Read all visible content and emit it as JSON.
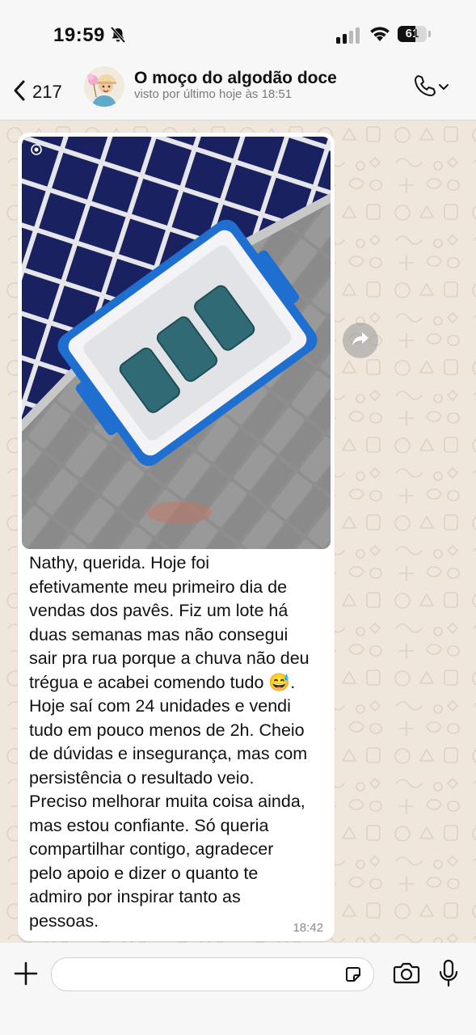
{
  "status_bar": {
    "time": "19:59",
    "battery": "61",
    "icons": [
      "bell-slash-icon",
      "signal-icon",
      "wifi-icon",
      "battery-icon"
    ]
  },
  "header": {
    "back_count": "217",
    "contact_name": "O moço do algodão doce",
    "last_seen": "visto por último hoje às 18:51",
    "icons": [
      "chevron-left-icon",
      "phone-icon",
      "chevron-down-icon"
    ]
  },
  "message": {
    "text": "Nathy, querida. Hoje foi\nefetivamente meu primeiro dia de\nvendas dos pavês. Fiz um lote há\nduas semanas mas não consegui\nsair pra rua porque a chuva não deu\ntrégua e acabei comendo tudo 😅.\nHoje saí com 24 unidades e vendi\ntudo em pouco menos de 2h. Cheio\nde dúvidas e insegurança, mas com\npersistência o resultado veio.\nPreciso melhorar muita coisa ainda,\nmas estou confiante. Só queria\ncompartilhar contigo, agradecer\npelo apoio e dizer o quanto te\nadmiro por inspirar tanto as\npessoas.",
    "time": "18:42",
    "photo": "cooler-box-photo"
  },
  "composer": {
    "placeholder": "",
    "icons": [
      "plus-icon",
      "sticker-icon",
      "camera-icon",
      "microphone-icon"
    ]
  },
  "colors": {
    "chat_background": "#efe7dc",
    "bubble": "#ffffff",
    "bar_background": "#f7f7f7",
    "cooler_blue": "#1f6fd0",
    "tile_navy": "#141a52"
  }
}
